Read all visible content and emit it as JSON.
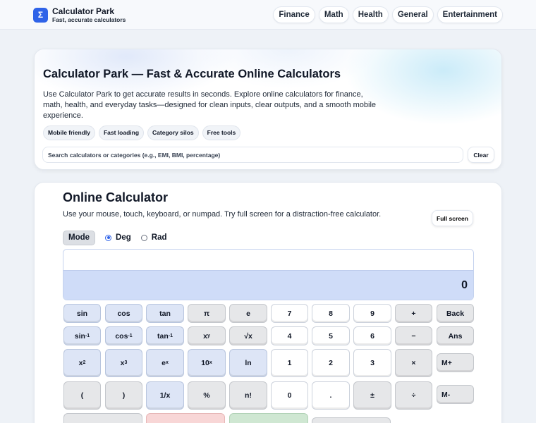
{
  "header": {
    "logo_glyph": "Σ",
    "brand": "Calculator Park",
    "tagline": "Fast, accurate calculators",
    "nav": [
      "Finance",
      "Math",
      "Health",
      "General",
      "Entertainment"
    ]
  },
  "hero": {
    "title": "Calculator Park — Fast & Accurate Online Calculators",
    "description": "Use Calculator Park to get accurate results in seconds. Explore online calculators for finance, math, health, and everyday tasks—designed for clean inputs, clear outputs, and a smooth mobile experience.",
    "tags": [
      "Mobile friendly",
      "Fast loading",
      "Category silos",
      "Free tools"
    ],
    "search_placeholder": "Search calculators or categories (e.g., EMI, BMI, percentage)",
    "clear_label": "Clear"
  },
  "calculator": {
    "title": "Online Calculator",
    "subtitle": "Use your mouse, touch, keyboard, or numpad. Try full screen for a distraction-free calculator.",
    "fullscreen_label": "Full screen",
    "mode_label": "Mode",
    "angle_options": [
      "Deg",
      "Rad"
    ],
    "angle_selected": "Deg",
    "expression": "",
    "result": "0",
    "keys": {
      "sin": "sin",
      "cos": "cos",
      "tan": "tan",
      "pi": "π",
      "e": "e",
      "n7": "7",
      "n8": "8",
      "n9": "9",
      "plus": "+",
      "back": "Back",
      "asin": "sin⁻¹",
      "acos": "cos⁻¹",
      "atan": "tan⁻¹",
      "pow": "xʸ",
      "sqrt": "√x",
      "n4": "4",
      "n5": "5",
      "n6": "6",
      "minus": "−",
      "ans": "Ans",
      "sq": "x²",
      "cube": "x³",
      "exp": "eˣ",
      "tenx": "10ˣ",
      "ln": "ln",
      "n1": "1",
      "n2": "2",
      "n3": "3",
      "mul": "×",
      "mplus": "M+",
      "lparen": "(",
      "rparen": ")",
      "recip": "1/x",
      "percent": "%",
      "fact": "n!",
      "n0": "0",
      "dot": ".",
      "pm": "±",
      "div": "÷",
      "mminus": "M-"
    }
  },
  "colors": {
    "accent": "#2f63e8",
    "display_result_bg": "#cfdcf8",
    "function_key_bg": "#dde5f6",
    "number_key_bg": "#ffffff",
    "operator_key_bg": "#e6e7e9",
    "clear_key_bg": "#f8d6d6",
    "equals_key_bg": "#cfe7d2"
  }
}
